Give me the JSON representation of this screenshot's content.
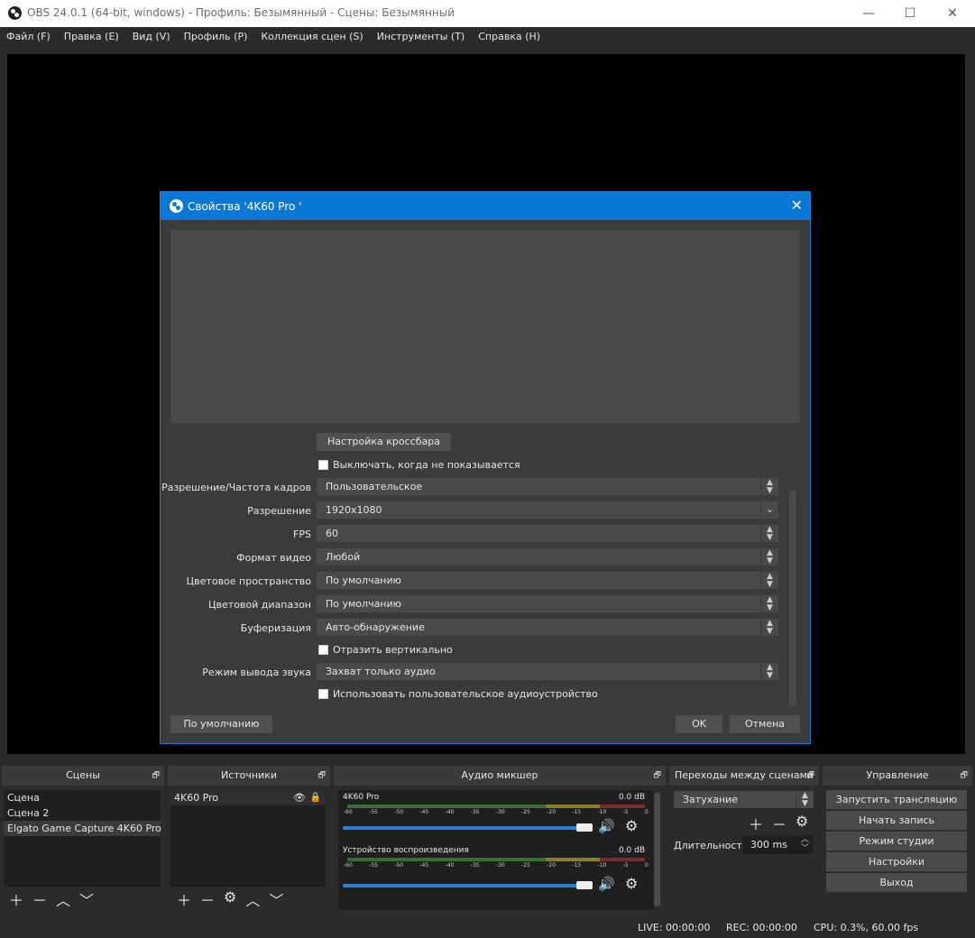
{
  "window": {
    "title": "OBS 24.0.1 (64-bit, windows) - Профиль: Безымянный - Сцены: Безымянный"
  },
  "menu": [
    "Файл (F)",
    "Правка (E)",
    "Вид (V)",
    "Профиль (P)",
    "Коллекция сцен (S)",
    "Инструменты (T)",
    "Справка (H)"
  ],
  "dialog": {
    "title": "Свойства '4K60 Pro '",
    "crossbar_button": "Настройка кроссбара",
    "deactivate_checkbox": "Выключать, когда не показывается",
    "fields": [
      {
        "label": "Разрешение/Частота кадров",
        "value": "Пользовательское",
        "control": "updown"
      },
      {
        "label": "Разрешение",
        "value": "1920x1080",
        "control": "dropdown"
      },
      {
        "label": "FPS",
        "value": "60",
        "control": "updown"
      },
      {
        "label": "Формат видео",
        "value": "Любой",
        "control": "updown"
      },
      {
        "label": "Цветовое пространство",
        "value": "По умолчанию",
        "control": "updown"
      },
      {
        "label": "Цветовой диапазон",
        "value": "По умолчанию",
        "control": "updown"
      },
      {
        "label": "Буферизация",
        "value": "Авто-обнаружение",
        "control": "updown"
      }
    ],
    "flip_checkbox": "Отразить вертикально",
    "audio_mode": {
      "label": "Режим вывода звука",
      "value": "Захват только аудио"
    },
    "custom_audio_checkbox": "Использовать пользовательское аудиоустройство",
    "defaults_button": "По умолчанию",
    "ok_button": "OK",
    "cancel_button": "Отмена"
  },
  "docks": {
    "scenes": {
      "title": "Сцены",
      "items": [
        "Сцена",
        "Сцена 2",
        "Elgato Game Capture 4K60 Pro"
      ],
      "selected": 2
    },
    "sources": {
      "title": "Источники",
      "items": [
        "4K60 Pro"
      ]
    },
    "mixer": {
      "title": "Аудио микшер",
      "channels": [
        {
          "name": "4K60 Pro",
          "level": "0.0 dB"
        },
        {
          "name": "Устройство воспроизведения",
          "level": "0.0 dB"
        }
      ],
      "ticks": [
        "-60",
        "-55",
        "-50",
        "-45",
        "-40",
        "-35",
        "-30",
        "-25",
        "-20",
        "-15",
        "-10",
        "-5",
        "0"
      ]
    },
    "transitions": {
      "title": "Переходы между сценами",
      "selected": "Затухание",
      "duration_label": "Длительность",
      "duration_value": "300 ms"
    },
    "controls": {
      "title": "Управление",
      "buttons": [
        "Запустить трансляцию",
        "Начать запись",
        "Режим студии",
        "Настройки",
        "Выход"
      ]
    }
  },
  "status": {
    "live": "LIVE: 00:00:00",
    "rec": "REC: 00:00:00",
    "cpu": "CPU: 0.3%, 60.00 fps"
  },
  "colors": {
    "accent": "#0b78d7",
    "background": "#2b2b2b",
    "meter_green": "#4fae4f",
    "meter_yellow": "#b8a72a",
    "meter_red": "#c43c3c"
  }
}
